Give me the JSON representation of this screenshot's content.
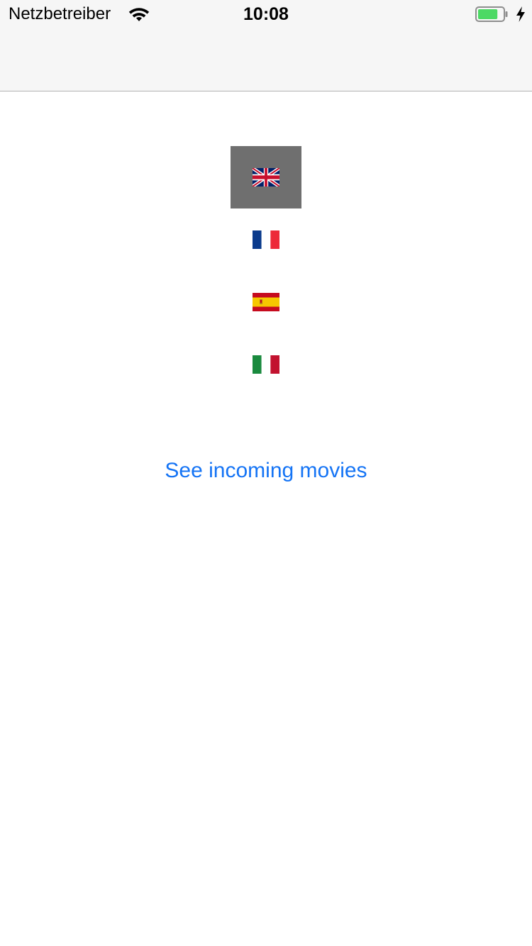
{
  "status_bar": {
    "carrier": "Netzbetreiber",
    "time": "10:08",
    "wifi_icon": "wifi-icon",
    "battery_icon": "battery-charging-icon",
    "battery_level": 0.8
  },
  "languages": {
    "selected": "english",
    "items": [
      {
        "id": "english",
        "icon": "uk-flag-icon"
      },
      {
        "id": "french",
        "icon": "france-flag-icon"
      },
      {
        "id": "spanish",
        "icon": "spain-flag-icon"
      },
      {
        "id": "italian",
        "icon": "italy-flag-icon"
      }
    ]
  },
  "main": {
    "cta_label": "See incoming movies"
  },
  "colors": {
    "accent": "#1574f5",
    "selected_bg": "#6f6f6f",
    "nav_bg": "#f6f6f6",
    "battery_fill": "#4cd964"
  }
}
